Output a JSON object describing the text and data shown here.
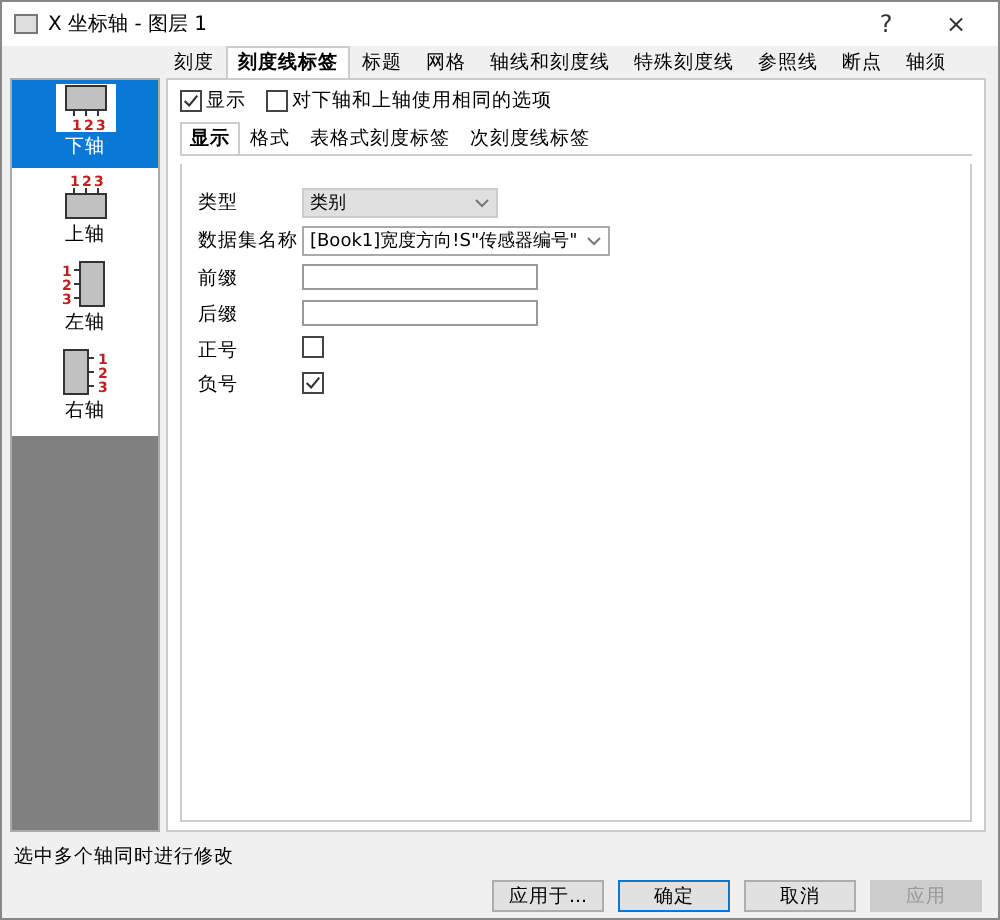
{
  "window": {
    "title": "X 坐标轴 - 图层 1",
    "help": "?",
    "close": "×"
  },
  "tabs": [
    {
      "label": "刻度",
      "selected": false
    },
    {
      "label": "刻度线标签",
      "selected": true
    },
    {
      "label": "标题",
      "selected": false
    },
    {
      "label": "网格",
      "selected": false
    },
    {
      "label": "轴线和刻度线",
      "selected": false
    },
    {
      "label": "特殊刻度线",
      "selected": false
    },
    {
      "label": "参照线",
      "selected": false
    },
    {
      "label": "断点",
      "selected": false
    },
    {
      "label": "轴须",
      "selected": false
    }
  ],
  "sidebar": {
    "items": [
      {
        "label": "下轴",
        "kind": "bottom",
        "ticks": [
          "1",
          "2",
          "3"
        ],
        "selected": true
      },
      {
        "label": "上轴",
        "kind": "top",
        "ticks": [
          "1",
          "2",
          "3"
        ],
        "selected": false
      },
      {
        "label": "左轴",
        "kind": "left",
        "ticks": [
          "1",
          "2",
          "3"
        ],
        "selected": false
      },
      {
        "label": "右轴",
        "kind": "right",
        "ticks": [
          "1",
          "2",
          "3"
        ],
        "selected": false
      }
    ]
  },
  "options": [
    {
      "label": "显示",
      "checked": true
    },
    {
      "label": "对下轴和上轴使用相同的选项",
      "checked": false
    }
  ],
  "subtabs": [
    {
      "label": "显示",
      "selected": true
    },
    {
      "label": "格式",
      "selected": false
    },
    {
      "label": "表格式刻度标签",
      "selected": false
    },
    {
      "label": "次刻度线标签",
      "selected": false
    }
  ],
  "form": [
    {
      "kind": "dropdown",
      "label": "类型",
      "value": "类别",
      "disabled": true
    },
    {
      "kind": "dropdown",
      "label": "数据集名称",
      "value": "[Book1]宽度方向!S\"传感器编号\"",
      "disabled": false
    },
    {
      "kind": "text",
      "label": "前缀"
    },
    {
      "kind": "text",
      "label": "后缀"
    },
    {
      "kind": "checkbox",
      "label": "正号",
      "checked": false
    },
    {
      "kind": "checkbox",
      "label": "负号",
      "checked": true
    }
  ],
  "status_bar": "选中多个轴同时进行修改",
  "buttons": [
    {
      "label": "应用于...",
      "kind": "normal",
      "disabled": false
    },
    {
      "label": "确定",
      "kind": "default",
      "disabled": false
    },
    {
      "label": "取消",
      "kind": "normal",
      "disabled": false
    },
    {
      "label": "应用",
      "kind": "normal",
      "disabled": true
    }
  ]
}
